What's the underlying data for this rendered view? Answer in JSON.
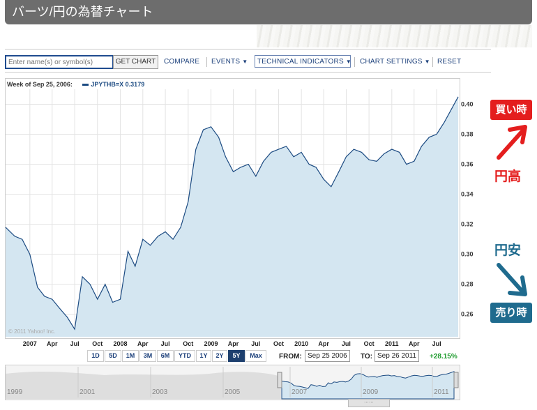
{
  "title": "バーツ/円の為替チャート",
  "toolbar": {
    "search_placeholder": "Enter name(s) or symbol(s)",
    "get_chart": "GET CHART",
    "compare": "COMPARE",
    "events": "EVENTS",
    "technical_indicators": "TECHNICAL INDICATORS",
    "chart_settings": "CHART SETTINGS",
    "reset": "RESET"
  },
  "legend": {
    "week_label": "Week of Sep 25, 2006:",
    "symbol_text": "JPYTHB=X 0.3179",
    "copyright": "© 2011 Yahoo! Inc."
  },
  "periods": [
    "1D",
    "5D",
    "1M",
    "3M",
    "6M",
    "YTD",
    "1Y",
    "2Y",
    "5Y",
    "Max"
  ],
  "active_period": "5Y",
  "range": {
    "from_label": "FROM:",
    "from_value": "Sep 25 2006",
    "to_label": "TO:",
    "to_value": "Sep 26 2011",
    "change": "+28.15%"
  },
  "navigator": {
    "years": [
      "1999",
      "2001",
      "2003",
      "2005",
      "2007",
      "2009",
      "2011"
    ]
  },
  "annotations": {
    "buy": "買い時",
    "yen_strong": "円高",
    "yen_weak": "円安",
    "sell": "売り時"
  },
  "colors": {
    "title_bg": "#6d6d6d",
    "line": "#1c4b82",
    "fill": "#d4e6f1",
    "buy_badge": "#e41e1e",
    "sell_badge": "#1f6b8e",
    "strong_text": "#e41e1e",
    "weak_text": "#1f6b8e",
    "change_positive": "#1a9a2a"
  },
  "chart_data": {
    "type": "area",
    "x_ticks": [
      "2007",
      "Apr",
      "Jul",
      "Oct",
      "2008",
      "Apr",
      "Jul",
      "Oct",
      "2009",
      "Apr",
      "Jul",
      "Oct",
      "2010",
      "Apr",
      "Jul",
      "Oct",
      "2011",
      "Apr",
      "Jul"
    ],
    "y_ticks": [
      0.26,
      0.28,
      0.3,
      0.32,
      0.34,
      0.36,
      0.38,
      0.4
    ],
    "ylim": [
      0.245,
      0.41
    ],
    "xlim": [
      "2006-09-25",
      "2011-09-26"
    ],
    "grid": true,
    "series": [
      {
        "name": "JPYTHB=X",
        "x": [
          "2006-09-25",
          "2006-11-01",
          "2006-12-01",
          "2007-01-01",
          "2007-02-01",
          "2007-03-01",
          "2007-04-01",
          "2007-05-01",
          "2007-06-01",
          "2007-07-01",
          "2007-08-01",
          "2007-09-01",
          "2007-10-01",
          "2007-11-01",
          "2007-12-01",
          "2008-01-01",
          "2008-02-01",
          "2008-03-01",
          "2008-04-01",
          "2008-05-01",
          "2008-06-01",
          "2008-07-01",
          "2008-08-01",
          "2008-09-01",
          "2008-10-01",
          "2008-11-01",
          "2008-12-01",
          "2009-01-01",
          "2009-02-01",
          "2009-03-01",
          "2009-04-01",
          "2009-05-01",
          "2009-06-01",
          "2009-07-01",
          "2009-08-01",
          "2009-09-01",
          "2009-10-01",
          "2009-11-01",
          "2009-12-01",
          "2010-01-01",
          "2010-02-01",
          "2010-03-01",
          "2010-04-01",
          "2010-05-01",
          "2010-06-01",
          "2010-07-01",
          "2010-08-01",
          "2010-09-01",
          "2010-10-01",
          "2010-11-01",
          "2010-12-01",
          "2011-01-01",
          "2011-02-01",
          "2011-03-01",
          "2011-04-01",
          "2011-05-01",
          "2011-06-01",
          "2011-07-01",
          "2011-08-01",
          "2011-09-26"
        ],
        "values": [
          0.318,
          0.312,
          0.31,
          0.3,
          0.278,
          0.272,
          0.27,
          0.264,
          0.258,
          0.25,
          0.285,
          0.28,
          0.27,
          0.28,
          0.268,
          0.27,
          0.302,
          0.292,
          0.31,
          0.306,
          0.312,
          0.315,
          0.31,
          0.318,
          0.335,
          0.37,
          0.383,
          0.385,
          0.378,
          0.365,
          0.355,
          0.358,
          0.36,
          0.352,
          0.362,
          0.368,
          0.37,
          0.372,
          0.365,
          0.368,
          0.36,
          0.358,
          0.35,
          0.345,
          0.355,
          0.365,
          0.37,
          0.368,
          0.363,
          0.362,
          0.367,
          0.37,
          0.368,
          0.36,
          0.362,
          0.372,
          0.378,
          0.38,
          0.388,
          0.405
        ]
      }
    ]
  }
}
